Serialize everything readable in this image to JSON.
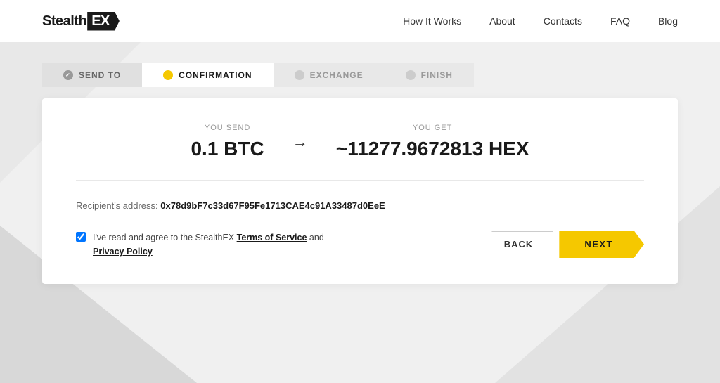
{
  "header": {
    "logo_text": "Stealth",
    "logo_ex": "EX",
    "nav": {
      "items": [
        {
          "label": "How It Works",
          "href": "#"
        },
        {
          "label": "About",
          "href": "#"
        },
        {
          "label": "Contacts",
          "href": "#"
        },
        {
          "label": "FAQ",
          "href": "#"
        },
        {
          "label": "Blog",
          "href": "#"
        }
      ]
    }
  },
  "stepper": {
    "steps": [
      {
        "id": "send-to",
        "label": "SEND TO",
        "state": "completed",
        "dot": "check"
      },
      {
        "id": "confirmation",
        "label": "CONFIRMATION",
        "state": "active",
        "dot": "yellow"
      },
      {
        "id": "exchange",
        "label": "EXCHANGE",
        "state": "inactive",
        "dot": "grey"
      },
      {
        "id": "finish",
        "label": "FINISH",
        "state": "inactive",
        "dot": "grey"
      }
    ]
  },
  "card": {
    "you_send_label": "YOU SEND",
    "you_send_amount": "0.1 BTC",
    "arrow": "→",
    "you_get_label": "YOU GET",
    "you_get_amount": "~11277.9672813 HEX",
    "recipient_label": "Recipient's address:",
    "recipient_address": "0x78d9bF7c33d67F95Fe1713CAE4c91A33487d0EeE",
    "agreement_prefix": "I've read and agree to the StealthEX ",
    "terms_label": "Terms of Service",
    "agreement_middle": " and",
    "privacy_label": "Privacy Policy",
    "back_button": "BACK",
    "next_button": "NEXT"
  }
}
